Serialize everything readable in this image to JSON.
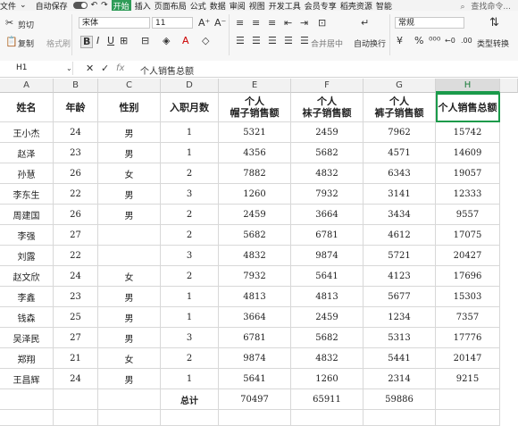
{
  "menu": {
    "file": "文件",
    "autosave": "自动保存",
    "tabs": [
      "开始",
      "插入",
      "页面布局",
      "公式",
      "数据",
      "审阅",
      "视图",
      "开发工具",
      "会员专享",
      "稻壳资源",
      "智能"
    ],
    "search": "查找命令..."
  },
  "ribbon": {
    "cut": "剪切",
    "copy": "复制",
    "format_painter": "格式刷",
    "font_name": "宋体",
    "font_size": "11",
    "merge_center": "合并居中",
    "wrap_text": "自动换行",
    "number_format": "常规",
    "type_convert": "类型转换"
  },
  "formula_bar": {
    "name_box": "H1",
    "fx": "fx",
    "content": "个人销售总额"
  },
  "columns": [
    "A",
    "B",
    "C",
    "D",
    "E",
    "F",
    "G",
    "H"
  ],
  "header_row": [
    "姓名",
    "年龄",
    "性别",
    "入职月数",
    "个人\n帽子销售额",
    "个人\n袜子销售额",
    "个人\n裤子销售额",
    "个人销售总额"
  ],
  "rows": [
    [
      "王小杰",
      "24",
      "男",
      "1",
      "5321",
      "2459",
      "7962",
      "15742"
    ],
    [
      "赵泽",
      "23",
      "男",
      "1",
      "4356",
      "5682",
      "4571",
      "14609"
    ],
    [
      "孙慧",
      "26",
      "女",
      "2",
      "7882",
      "4832",
      "6343",
      "19057"
    ],
    [
      "李东生",
      "22",
      "男",
      "3",
      "1260",
      "7932",
      "3141",
      "12333"
    ],
    [
      "周建国",
      "26",
      "男",
      "2",
      "2459",
      "3664",
      "3434",
      "9557"
    ],
    [
      "李强",
      "27",
      "",
      "2",
      "5682",
      "6781",
      "4612",
      "17075"
    ],
    [
      "刘露",
      "22",
      "",
      "3",
      "4832",
      "9874",
      "5721",
      "20427"
    ],
    [
      "赵文欣",
      "24",
      "女",
      "2",
      "7932",
      "5641",
      "4123",
      "17696"
    ],
    [
      "李鑫",
      "23",
      "男",
      "1",
      "4813",
      "4813",
      "5677",
      "15303"
    ],
    [
      "钱森",
      "25",
      "男",
      "1",
      "3664",
      "2459",
      "1234",
      "7357"
    ],
    [
      "吴泽民",
      "27",
      "男",
      "3",
      "6781",
      "5682",
      "5313",
      "17776"
    ],
    [
      "郑翔",
      "21",
      "女",
      "2",
      "9874",
      "4832",
      "5441",
      "20147"
    ],
    [
      "王昌辉",
      "24",
      "男",
      "1",
      "5641",
      "1260",
      "2314",
      "9215"
    ]
  ],
  "totals_row": [
    "",
    "",
    "",
    "总计",
    "70497",
    "65911",
    "59886",
    ""
  ]
}
